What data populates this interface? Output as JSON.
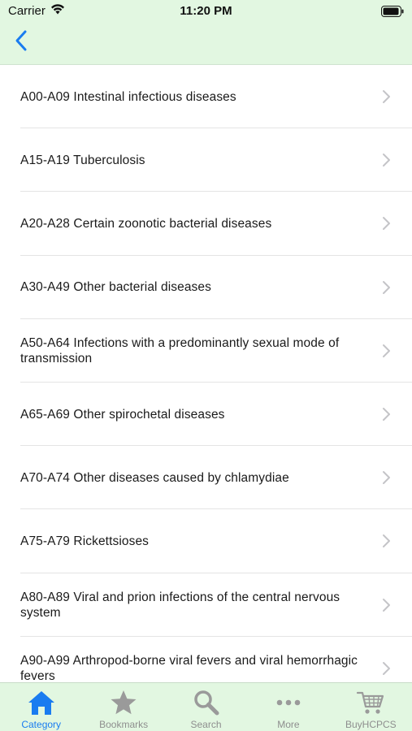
{
  "status_bar": {
    "carrier": "Carrier",
    "time": "11:20 PM"
  },
  "nav": {
    "back_icon": "chevron-left-icon"
  },
  "colors": {
    "accent": "#1a7cf0",
    "header_bg": "#e2f7e1",
    "inactive": "#8e8e8e"
  },
  "list": {
    "items": [
      {
        "label": "A00-A09  Intestinal infectious diseases"
      },
      {
        "label": "A15-A19  Tuberculosis"
      },
      {
        "label": "A20-A28  Certain zoonotic bacterial diseases"
      },
      {
        "label": "A30-A49  Other bacterial diseases"
      },
      {
        "label": "A50-A64  Infections with a predominantly sexual mode of transmission"
      },
      {
        "label": "A65-A69  Other spirochetal diseases"
      },
      {
        "label": "A70-A74  Other diseases caused by chlamydiae"
      },
      {
        "label": "A75-A79  Rickettsioses"
      },
      {
        "label": "A80-A89  Viral and prion infections of the central nervous system"
      },
      {
        "label": "A90-A99  Arthropod-borne viral fevers and viral hemorrhagic fevers"
      }
    ]
  },
  "tabs": [
    {
      "label": "Category",
      "icon": "home-icon",
      "active": true
    },
    {
      "label": "Bookmarks",
      "icon": "star-icon",
      "active": false
    },
    {
      "label": "Search",
      "icon": "search-icon",
      "active": false
    },
    {
      "label": "More",
      "icon": "more-icon",
      "active": false
    },
    {
      "label": "BuyHCPCS",
      "icon": "cart-icon",
      "active": false
    }
  ]
}
